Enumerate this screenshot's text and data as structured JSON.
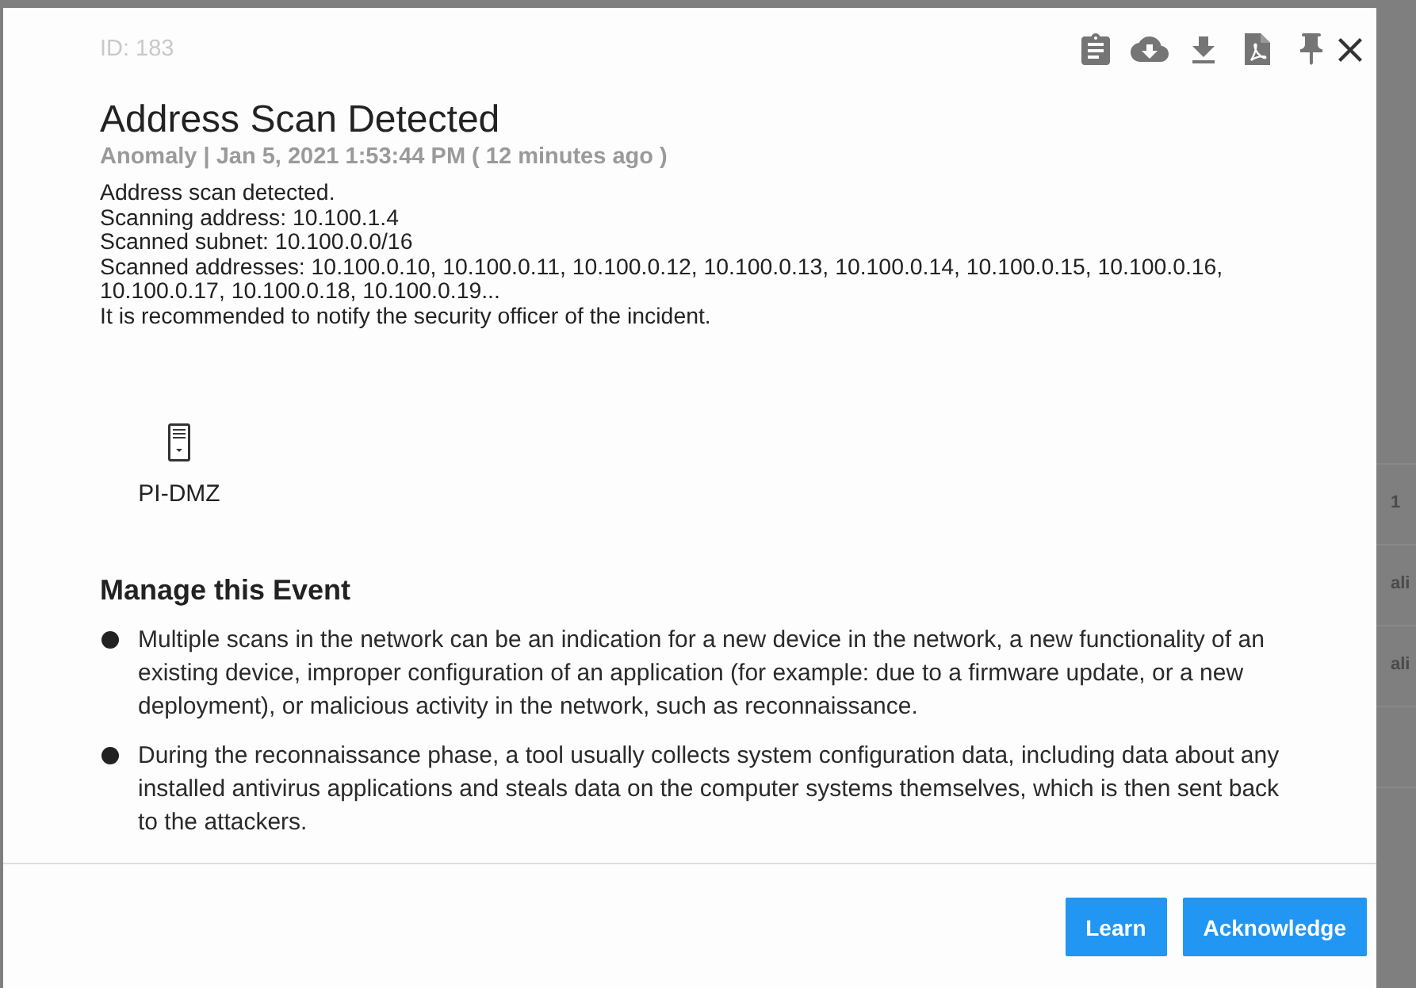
{
  "dialog": {
    "id": "ID: 183",
    "title": "Address Scan Detected",
    "subtitle": "Anomaly | Jan 5, 2021 1:53:44 PM ( 12 minutes ago )",
    "description": [
      "Address scan detected.",
      "Scanning address: 10.100.1.4",
      "Scanned subnet: 10.100.0.0/16",
      "Scanned addresses: 10.100.0.10, 10.100.0.11, 10.100.0.12, 10.100.0.13, 10.100.0.14, 10.100.0.15, 10.100.0.16, 10.100.0.17, 10.100.0.18, 10.100.0.19...",
      "It is recommended to notify the security officer of the incident."
    ],
    "devices": [
      {
        "name": "PI-DMZ"
      }
    ],
    "manage": {
      "heading": "Manage this Event",
      "items": [
        "Multiple scans in the network can be an indication for a new device in the network, a new functionality of an existing device, improper configuration of an application (for example: due to a firmware update, or a new deployment), or malicious activity in the network, such as reconnaissance.",
        "During the reconnaissance phase, a tool usually collects system configuration data, including data about any installed antivirus applications and steals data on the computer systems themselves, which is then sent back to the attackers."
      ]
    },
    "buttons": [
      "Learn",
      "Acknowledge"
    ]
  },
  "background": {
    "row_fragments": [
      "1",
      "ali",
      "ali"
    ]
  }
}
